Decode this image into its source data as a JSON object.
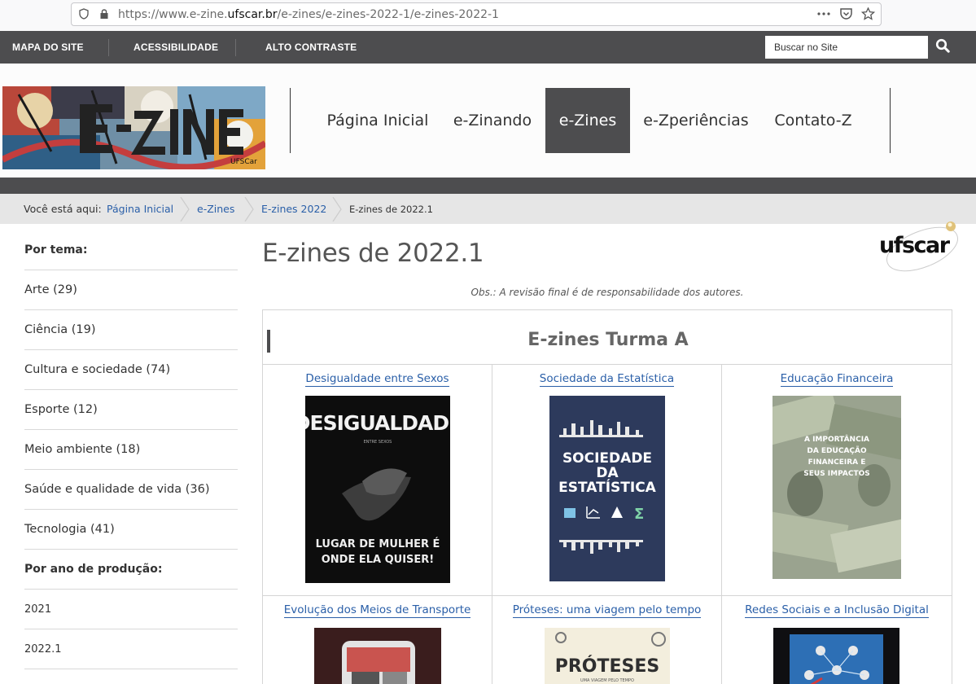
{
  "browser": {
    "url_prefix": "https://www.e-zine.",
    "url_domain": "ufscar.br",
    "url_path": "/e-zines/e-zines-2022-1/e-zines-2022-1"
  },
  "topbar": {
    "links": [
      "MAPA DO SITE",
      "ACESSIBILIDADE",
      "ALTO CONTRASTE"
    ],
    "search_placeholder": "Buscar no Site"
  },
  "logo": {
    "text": "E-ZINE",
    "badge": "UFSCar"
  },
  "nav": {
    "items": [
      "Página Inicial",
      "e-Zinando",
      "e-Zines",
      "e-Zperiências",
      "Contato-Z"
    ],
    "active_index": 2
  },
  "breadcrumb": {
    "prefix": "Você está aqui:",
    "links": [
      "Página Inicial",
      "e-Zines",
      "E-zines 2022"
    ],
    "current": "E-zines de 2022.1"
  },
  "sidebar": {
    "theme_heading": "Por tema:",
    "themes": [
      "Arte (29)",
      "Ciência (19)",
      "Cultura e sociedade (74)",
      "Esporte (12)",
      "Meio ambiente (18)",
      "Saúde e qualidade de vida (36)",
      "Tecnologia (41)"
    ],
    "year_heading": "Por ano de produção:",
    "years": [
      "2021",
      "2022.1"
    ]
  },
  "main": {
    "title": "E-zines de 2022.1",
    "ufscar_logo": "ufscar",
    "obs": "Obs.: A revisão final é de responsabilidade dos autores.",
    "section_title": "E-zines Turma A",
    "zines": [
      {
        "title": "Desigualdade entre Sexos",
        "cover_top": "DESIGUALDADE",
        "cover_sub": "ENTRE SEXOS",
        "cover_bottom_1": "LUGAR DE MULHER É",
        "cover_bottom_2": "ONDE ELA QUISER!"
      },
      {
        "title": "Sociedade da Estatística",
        "cover_line_1": "SOCIEDADE",
        "cover_line_2": "DA",
        "cover_line_3": "ESTATÍSTICA"
      },
      {
        "title": "Educação Financeira",
        "cover_line_1": "A IMPORTÂNCIA",
        "cover_line_2": "DA EDUCAÇÃO",
        "cover_line_3": "FINANCEIRA E",
        "cover_line_4": "SEUS IMPACTOS"
      },
      {
        "title": "Evolução dos Meios de Transporte"
      },
      {
        "title": "Próteses: uma viagem pelo tempo",
        "cover_text": "PRÓTESES",
        "cover_sub": "UMA VIAGEM PELO TEMPO"
      },
      {
        "title": "Redes Sociais e a Inclusão Digital"
      }
    ]
  },
  "colors": {
    "dark_bar": "#4d4d4f",
    "link": "#2a5fa8",
    "breadcrumb_bg": "#e6e6e6"
  }
}
